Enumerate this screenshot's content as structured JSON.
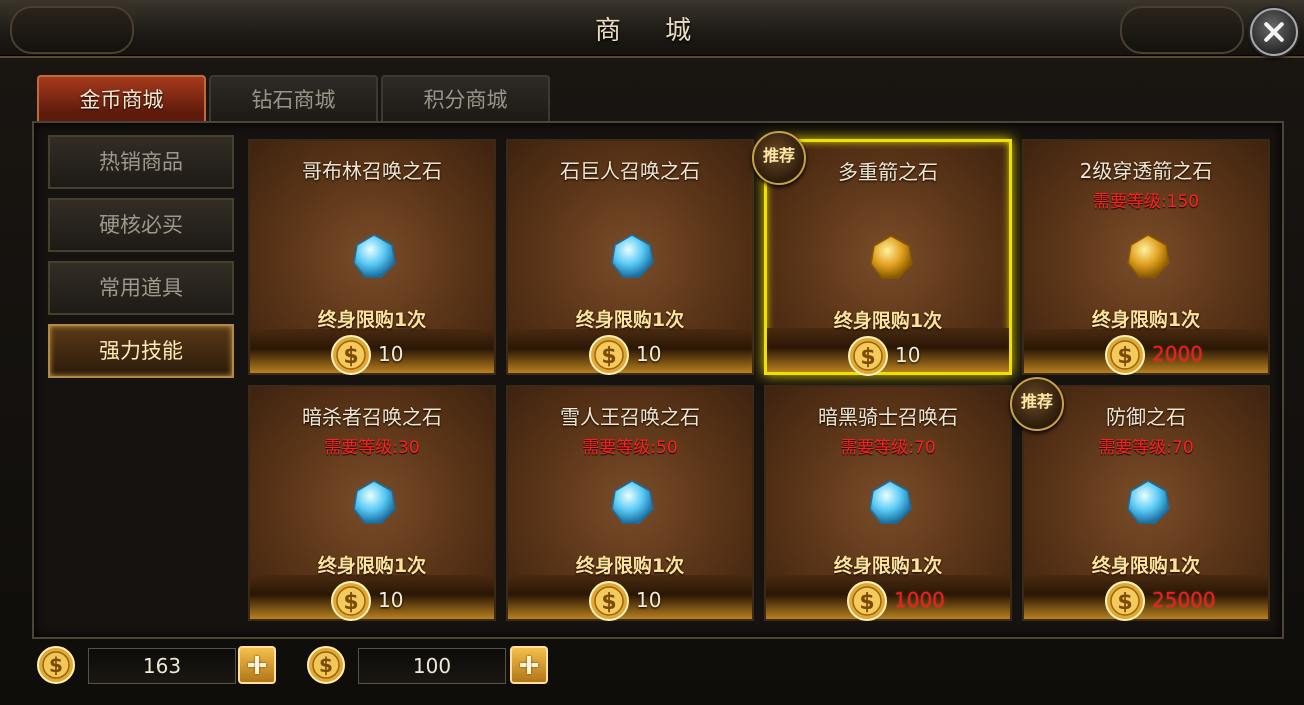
{
  "window": {
    "title": "商 城"
  },
  "tabs": [
    {
      "label": "金币商城",
      "active": true
    },
    {
      "label": "钻石商城",
      "active": false
    },
    {
      "label": "积分商城",
      "active": false
    }
  ],
  "sidebar": [
    {
      "label": "热销商品",
      "active": false
    },
    {
      "label": "硬核必买",
      "active": false
    },
    {
      "label": "常用道具",
      "active": false
    },
    {
      "label": "强力技能",
      "active": true
    }
  ],
  "badge_text": "推荐",
  "items": [
    {
      "name": "哥布林召唤之石",
      "requirement": "",
      "limit": "终身限购1次",
      "price": "10",
      "price_red": false,
      "gem": "blue",
      "badge": false,
      "selected": false
    },
    {
      "name": "石巨人召唤之石",
      "requirement": "",
      "limit": "终身限购1次",
      "price": "10",
      "price_red": false,
      "gem": "blue",
      "badge": false,
      "selected": false
    },
    {
      "name": "多重箭之石",
      "requirement": "",
      "limit": "终身限购1次",
      "price": "10",
      "price_red": false,
      "gem": "gold",
      "badge": true,
      "selected": true
    },
    {
      "name": "2级穿透箭之石",
      "requirement": "需要等级:150",
      "limit": "终身限购1次",
      "price": "2000",
      "price_red": true,
      "gem": "gold",
      "badge": false,
      "selected": false
    },
    {
      "name": "暗杀者召唤之石",
      "requirement": "需要等级:30",
      "limit": "终身限购1次",
      "price": "10",
      "price_red": false,
      "gem": "blue",
      "badge": false,
      "selected": false
    },
    {
      "name": "雪人王召唤之石",
      "requirement": "需要等级:50",
      "limit": "终身限购1次",
      "price": "10",
      "price_red": false,
      "gem": "blue",
      "badge": false,
      "selected": false
    },
    {
      "name": "暗黑骑士召唤石",
      "requirement": "需要等级:70",
      "limit": "终身限购1次",
      "price": "1000",
      "price_red": true,
      "gem": "blue",
      "badge": false,
      "selected": false
    },
    {
      "name": "防御之石",
      "requirement": "需要等级:70",
      "limit": "终身限购1次",
      "price": "25000",
      "price_red": true,
      "gem": "blue",
      "badge": true,
      "selected": false
    }
  ],
  "currency": [
    {
      "amount": "163",
      "icon": "gold-coin-icon"
    },
    {
      "amount": "100",
      "icon": "silver-coin-icon"
    }
  ],
  "colors": {
    "price_red": "#ff1818",
    "selected_border": "#f0e100",
    "active_tab": "#a63a1d"
  }
}
